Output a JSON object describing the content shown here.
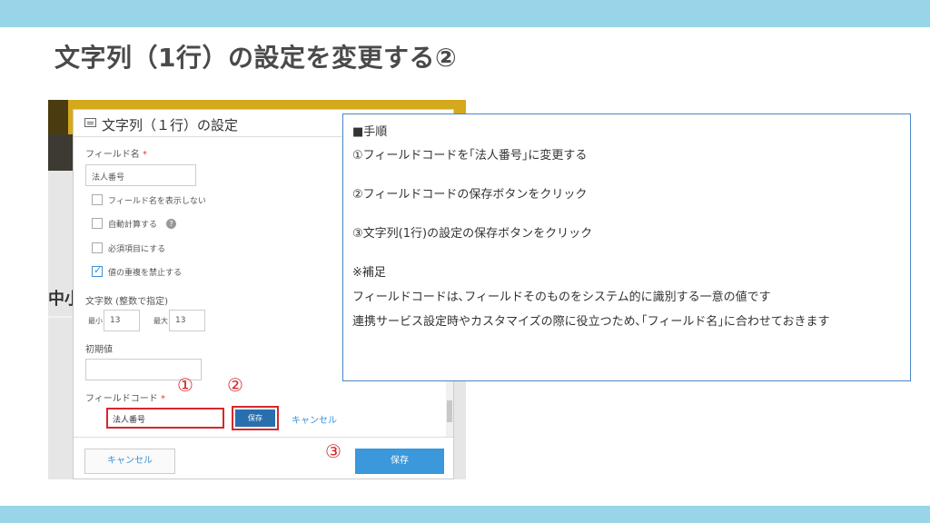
{
  "slide": {
    "title": "文字列（1行）の設定を変更する②"
  },
  "dialog": {
    "title": "文字列（１行）の設定",
    "field_name_label": "フィールド名",
    "required_mark": "*",
    "field_name_value": "法人番号",
    "checkboxes": [
      {
        "label": "フィールド名を表示しない",
        "checked": false
      },
      {
        "label": "自動計算する",
        "checked": false
      },
      {
        "label": "必須項目にする",
        "checked": false
      },
      {
        "label": "値の重複を禁止する",
        "checked": true
      }
    ],
    "char_count_label": "文字数 (整数で指定)",
    "min_label": "最小",
    "min_value": "13",
    "max_label": "最大",
    "max_value": "13",
    "default_label": "初期値",
    "field_code_label": "フィールドコード",
    "field_code_value": "法人番号",
    "save_small": "保存",
    "cancel_link": "キャンセル",
    "cancel_button": "キャンセル",
    "save_button": "保存"
  },
  "background": {
    "big_text": "中小"
  },
  "markers": {
    "one": "①",
    "two": "②",
    "three": "③"
  },
  "steps": {
    "heading": "■手順",
    "step1": "①フィールドコードを｢法人番号｣に変更する",
    "step2": "②フィールドコードの保存ボタンをクリック",
    "step3": "③文字列(1行)の設定の保存ボタンをクリック",
    "note_heading": "※補足",
    "note1": "フィールドコードは､フィールドそのものをシステム的に識別する一意の値です",
    "note2": "連携サービス設定時やカスタマイズの際に役立つため､｢フィールド名｣に合わせておきます"
  },
  "colors": {
    "band": "#99d5e8",
    "highlight": "#d9262b",
    "primary": "#3a98db",
    "box_border": "#4a86c5"
  }
}
